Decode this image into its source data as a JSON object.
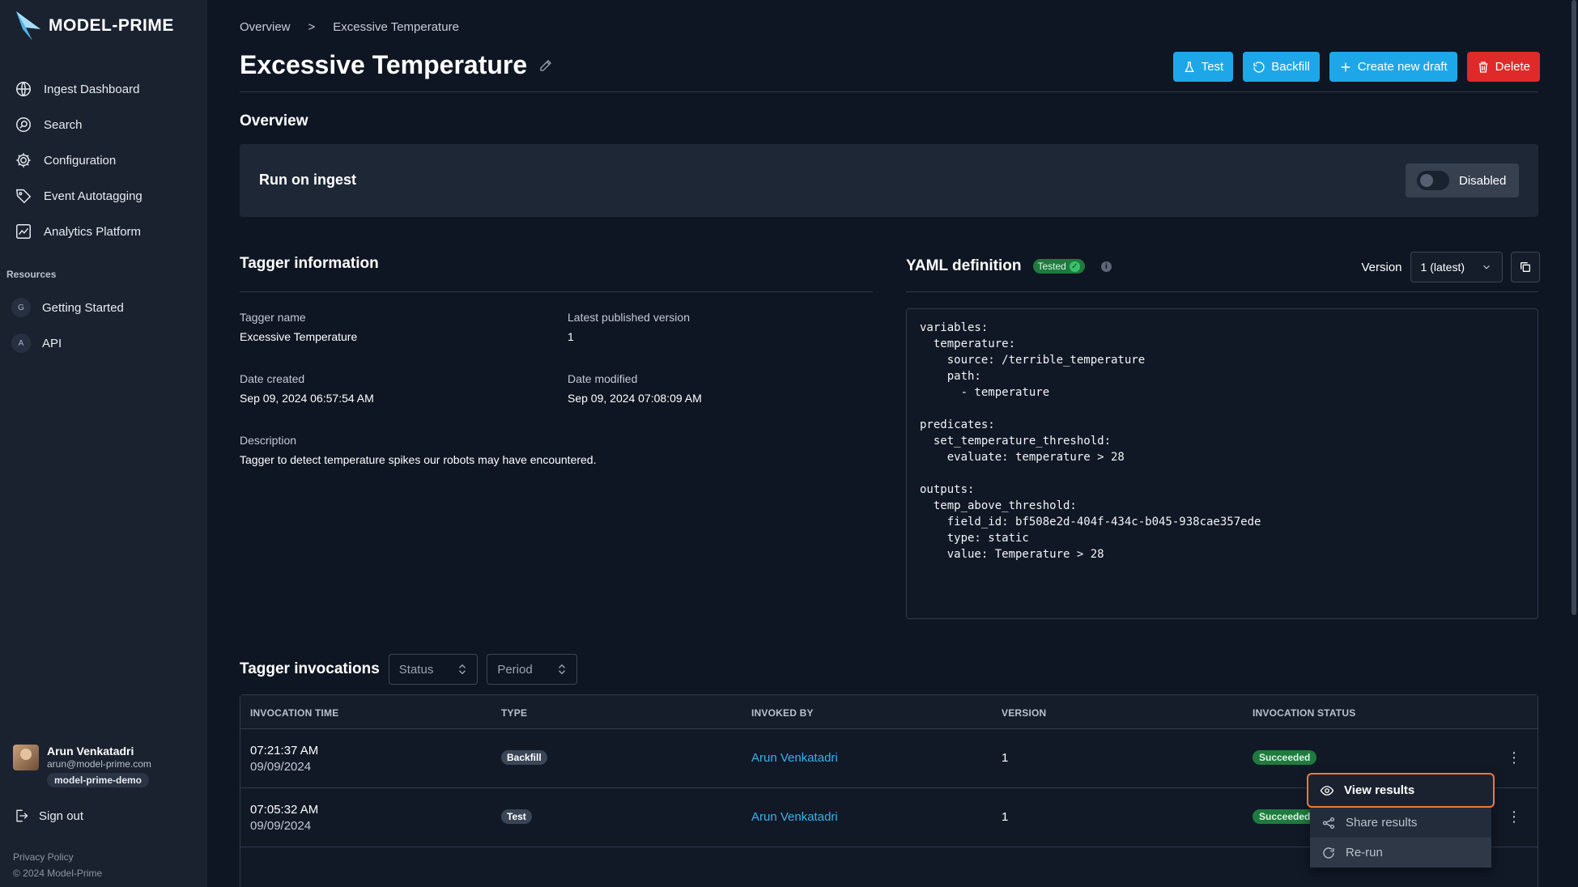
{
  "app": {
    "logo_text": "MODEL-PRIME"
  },
  "sidebar": {
    "items": [
      {
        "label": "Ingest Dashboard",
        "icon": "globe-icon"
      },
      {
        "label": "Search",
        "icon": "search-icon"
      },
      {
        "label": "Configuration",
        "icon": "gear-icon"
      },
      {
        "label": "Event Autotagging",
        "icon": "tag-icon"
      },
      {
        "label": "Analytics Platform",
        "icon": "chart-icon"
      }
    ],
    "resources_label": "Resources",
    "resources": [
      {
        "badge": "G",
        "label": "Getting Started"
      },
      {
        "badge": "A",
        "label": "API"
      }
    ],
    "user": {
      "name": "Arun Venkatadri",
      "email": "arun@model-prime.com",
      "org": "model-prime-demo"
    },
    "sign_out": "Sign out",
    "privacy": "Privacy Policy",
    "copyright": "© 2024 Model-Prime"
  },
  "breadcrumb": {
    "root": "Overview",
    "separator": ">",
    "current": "Excessive Temperature"
  },
  "page": {
    "title": "Excessive Temperature"
  },
  "actions": {
    "test": "Test",
    "backfill": "Backfill",
    "create_draft": "Create new draft",
    "delete": "Delete"
  },
  "overview": {
    "heading": "Overview",
    "run_on_ingest": "Run on ingest",
    "toggle_label": "Disabled",
    "toggle_on": false
  },
  "tagger_info": {
    "heading": "Tagger information",
    "name_label": "Tagger name",
    "name_value": "Excessive Temperature",
    "version_label": "Latest published version",
    "version_value": "1",
    "created_label": "Date created",
    "created_value": "Sep 09, 2024 06:57:54 AM",
    "modified_label": "Date modified",
    "modified_value": "Sep 09, 2024 07:08:09 AM",
    "description_label": "Description",
    "description_value": "Tagger to detect temperature spikes our robots may have encountered."
  },
  "yaml": {
    "heading": "YAML definition",
    "badge": "Tested",
    "version_label": "Version",
    "version_selected": "1 (latest)",
    "code": "variables:\n  temperature:\n    source: /terrible_temperature\n    path:\n      - temperature\n\npredicates:\n  set_temperature_threshold:\n    evaluate: temperature > 28\n\noutputs:\n  temp_above_threshold:\n    field_id: bf508e2d-404f-434c-b045-938cae357ede\n    type: static\n    value: Temperature > 28"
  },
  "invocations": {
    "heading": "Tagger invocations",
    "filter_status": "Status",
    "filter_period": "Period",
    "columns": [
      "INVOCATION TIME",
      "TYPE",
      "INVOKED BY",
      "VERSION",
      "INVOCATION STATUS"
    ],
    "rows": [
      {
        "time": "07:21:37 AM",
        "date": "09/09/2024",
        "type": "Backfill",
        "invoked_by": "Arun Venkatadri",
        "version": "1",
        "status": "Succeeded"
      },
      {
        "time": "07:05:32 AM",
        "date": "09/09/2024",
        "type": "Test",
        "invoked_by": "Arun Venkatadri",
        "version": "1",
        "status": "Succeeded"
      }
    ]
  },
  "context_menu": {
    "items": [
      "View results",
      "Share results",
      "Re-run"
    ]
  },
  "colors": {
    "accent_blue": "#1ea7e8",
    "danger_red": "#e02929",
    "success_green": "#1f7a3e",
    "focus_orange": "#ec7a35",
    "link_blue": "#3ab1ec"
  }
}
